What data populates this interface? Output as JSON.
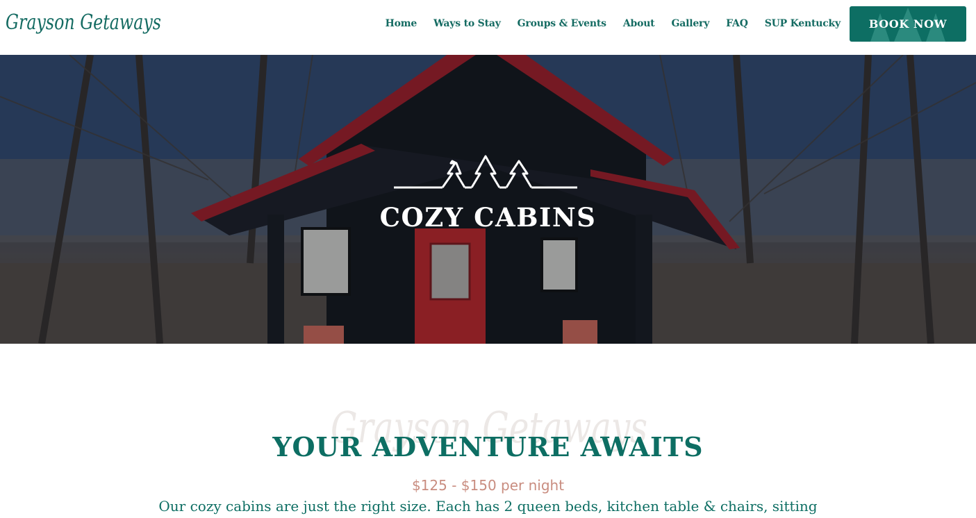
{
  "brand": {
    "logo_text": "Grayson Getaways",
    "color": "#0d6e63"
  },
  "nav": {
    "items": [
      "Home",
      "Ways to Stay",
      "Groups & Events",
      "About",
      "Gallery",
      "FAQ",
      "SUP Kentucky"
    ],
    "book_label": "BOOK NOW"
  },
  "hero": {
    "title": "COZY CABINS",
    "icon": "three-trees-icon"
  },
  "section": {
    "watermark": "Grayson Getaways",
    "title": "YOUR ADVENTURE AWAITS",
    "price": "$125 - $150 per night",
    "description": "Our cozy cabins are just the right size. Each has 2 queen beds, kitchen table & chairs, sitting"
  },
  "colors": {
    "accent": "#0d6e63",
    "price": "#c98d80",
    "cabin_door": "#d0282c",
    "cabin_roof": "#b0202a"
  }
}
